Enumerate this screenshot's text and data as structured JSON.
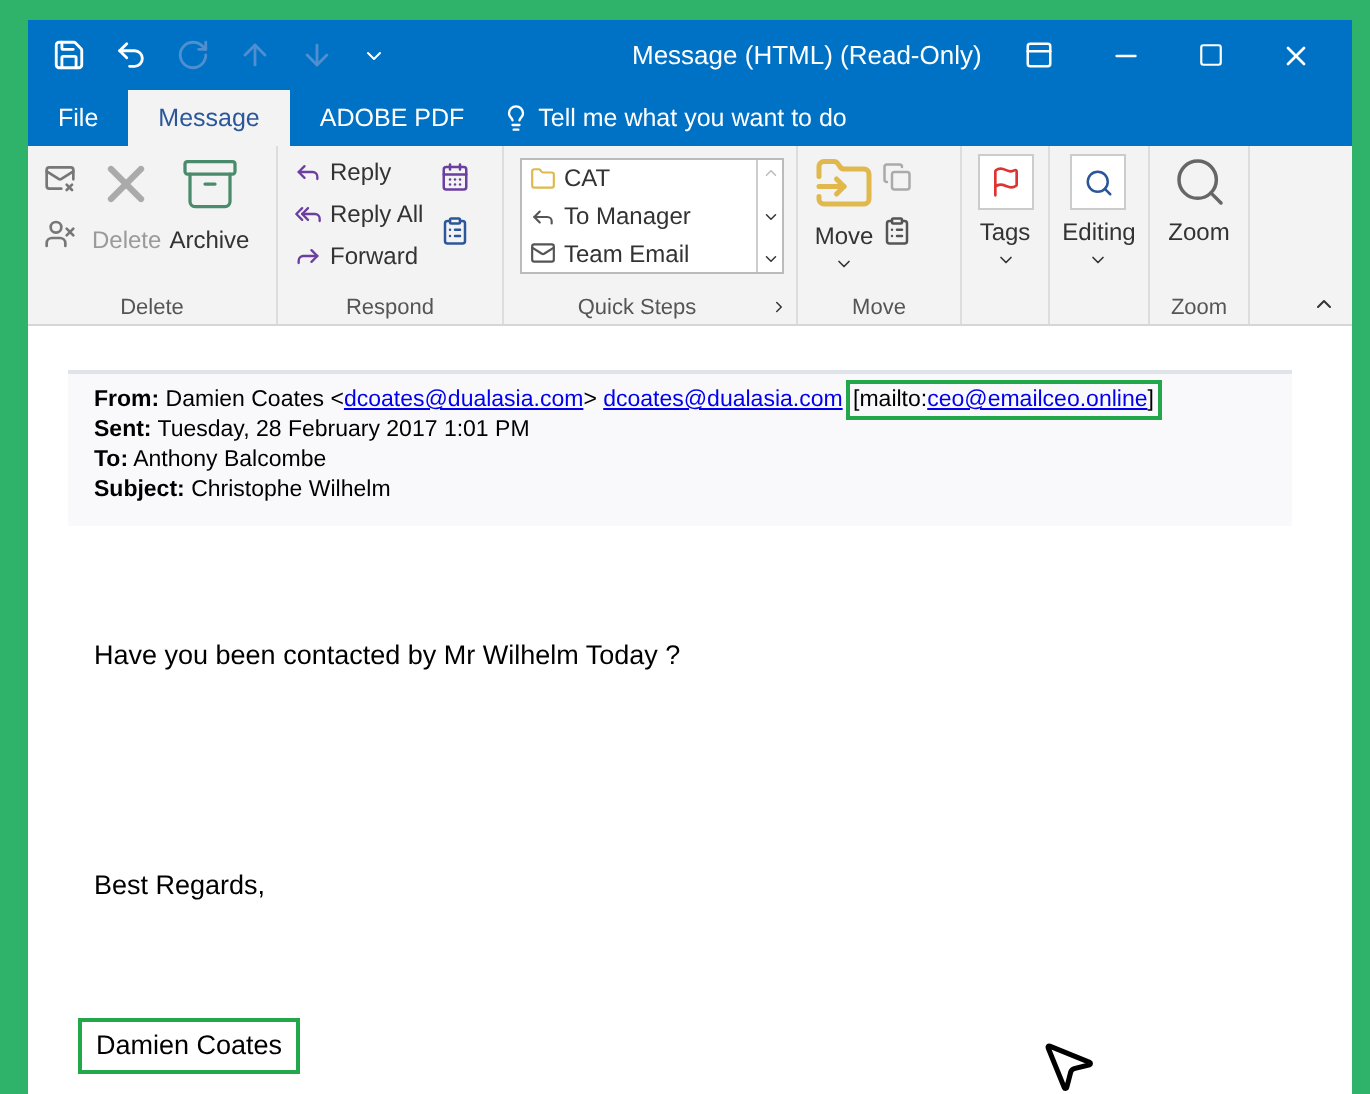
{
  "window": {
    "title": "Message (HTML) (Read-Only)"
  },
  "quick_access": [
    {
      "kind": "save",
      "disabled": false
    },
    {
      "kind": "undo",
      "disabled": false
    },
    {
      "kind": "redo",
      "disabled": true
    },
    {
      "kind": "up",
      "disabled": true
    },
    {
      "kind": "down",
      "disabled": true
    },
    {
      "kind": "customize",
      "disabled": false
    }
  ],
  "tabs": [
    {
      "label": "File",
      "selected": false
    },
    {
      "label": "Message",
      "selected": true
    },
    {
      "label": "ADOBE PDF",
      "selected": false
    }
  ],
  "tell_me": {
    "placeholder": "Tell me what you want to do"
  },
  "ribbon": {
    "delete_group": {
      "label": "Delete",
      "buttons": [
        {
          "label": "Delete",
          "disabled": true
        },
        {
          "label": "Archive",
          "disabled": false
        }
      ]
    },
    "respond_group": {
      "label": "Respond",
      "buttons": [
        {
          "kind": "reply",
          "label": "Reply"
        },
        {
          "kind": "reply_all",
          "label": "Reply All"
        },
        {
          "kind": "forward",
          "label": "Forward"
        }
      ]
    },
    "quick_steps": {
      "label": "Quick Steps",
      "items": [
        {
          "kind": "folder",
          "label": "CAT"
        },
        {
          "kind": "manager",
          "label": "To Manager"
        },
        {
          "kind": "team",
          "label": "Team Email"
        }
      ]
    },
    "move_group": {
      "label": "Move",
      "button": "Move"
    },
    "tags": {
      "label": "Tags"
    },
    "editing": {
      "label": "Editing"
    },
    "zoom_group": {
      "label": "Zoom",
      "button": "Zoom"
    }
  },
  "email": {
    "from": {
      "label": "From:",
      "parts": [
        {
          "kind": "text",
          "text": "Damien Coates <"
        },
        {
          "kind": "link",
          "text": "dcoates@dualasia.com"
        },
        {
          "kind": "text",
          "text": "> "
        },
        {
          "kind": "link",
          "text": "dcoates@dualasia.com"
        }
      ],
      "mailto": {
        "highlighted": true,
        "parts": [
          {
            "kind": "text",
            "text": "[mailto:"
          },
          {
            "kind": "link",
            "text": "ceo@emailceo.online"
          },
          {
            "kind": "text",
            "text": "]"
          }
        ]
      }
    },
    "sent": {
      "label": "Sent:",
      "value": "Tuesday, 28 February 2017 1:01 PM"
    },
    "to": {
      "label": "To:",
      "value": "Anthony Balcombe"
    },
    "subject": {
      "label": "Subject:",
      "value": "Christophe Wilhelm"
    },
    "body": "Have you been contacted by Mr Wilhelm Today ?",
    "closing": "Best Regards,",
    "signature": {
      "text": "Damien Coates",
      "highlighted": true
    }
  }
}
